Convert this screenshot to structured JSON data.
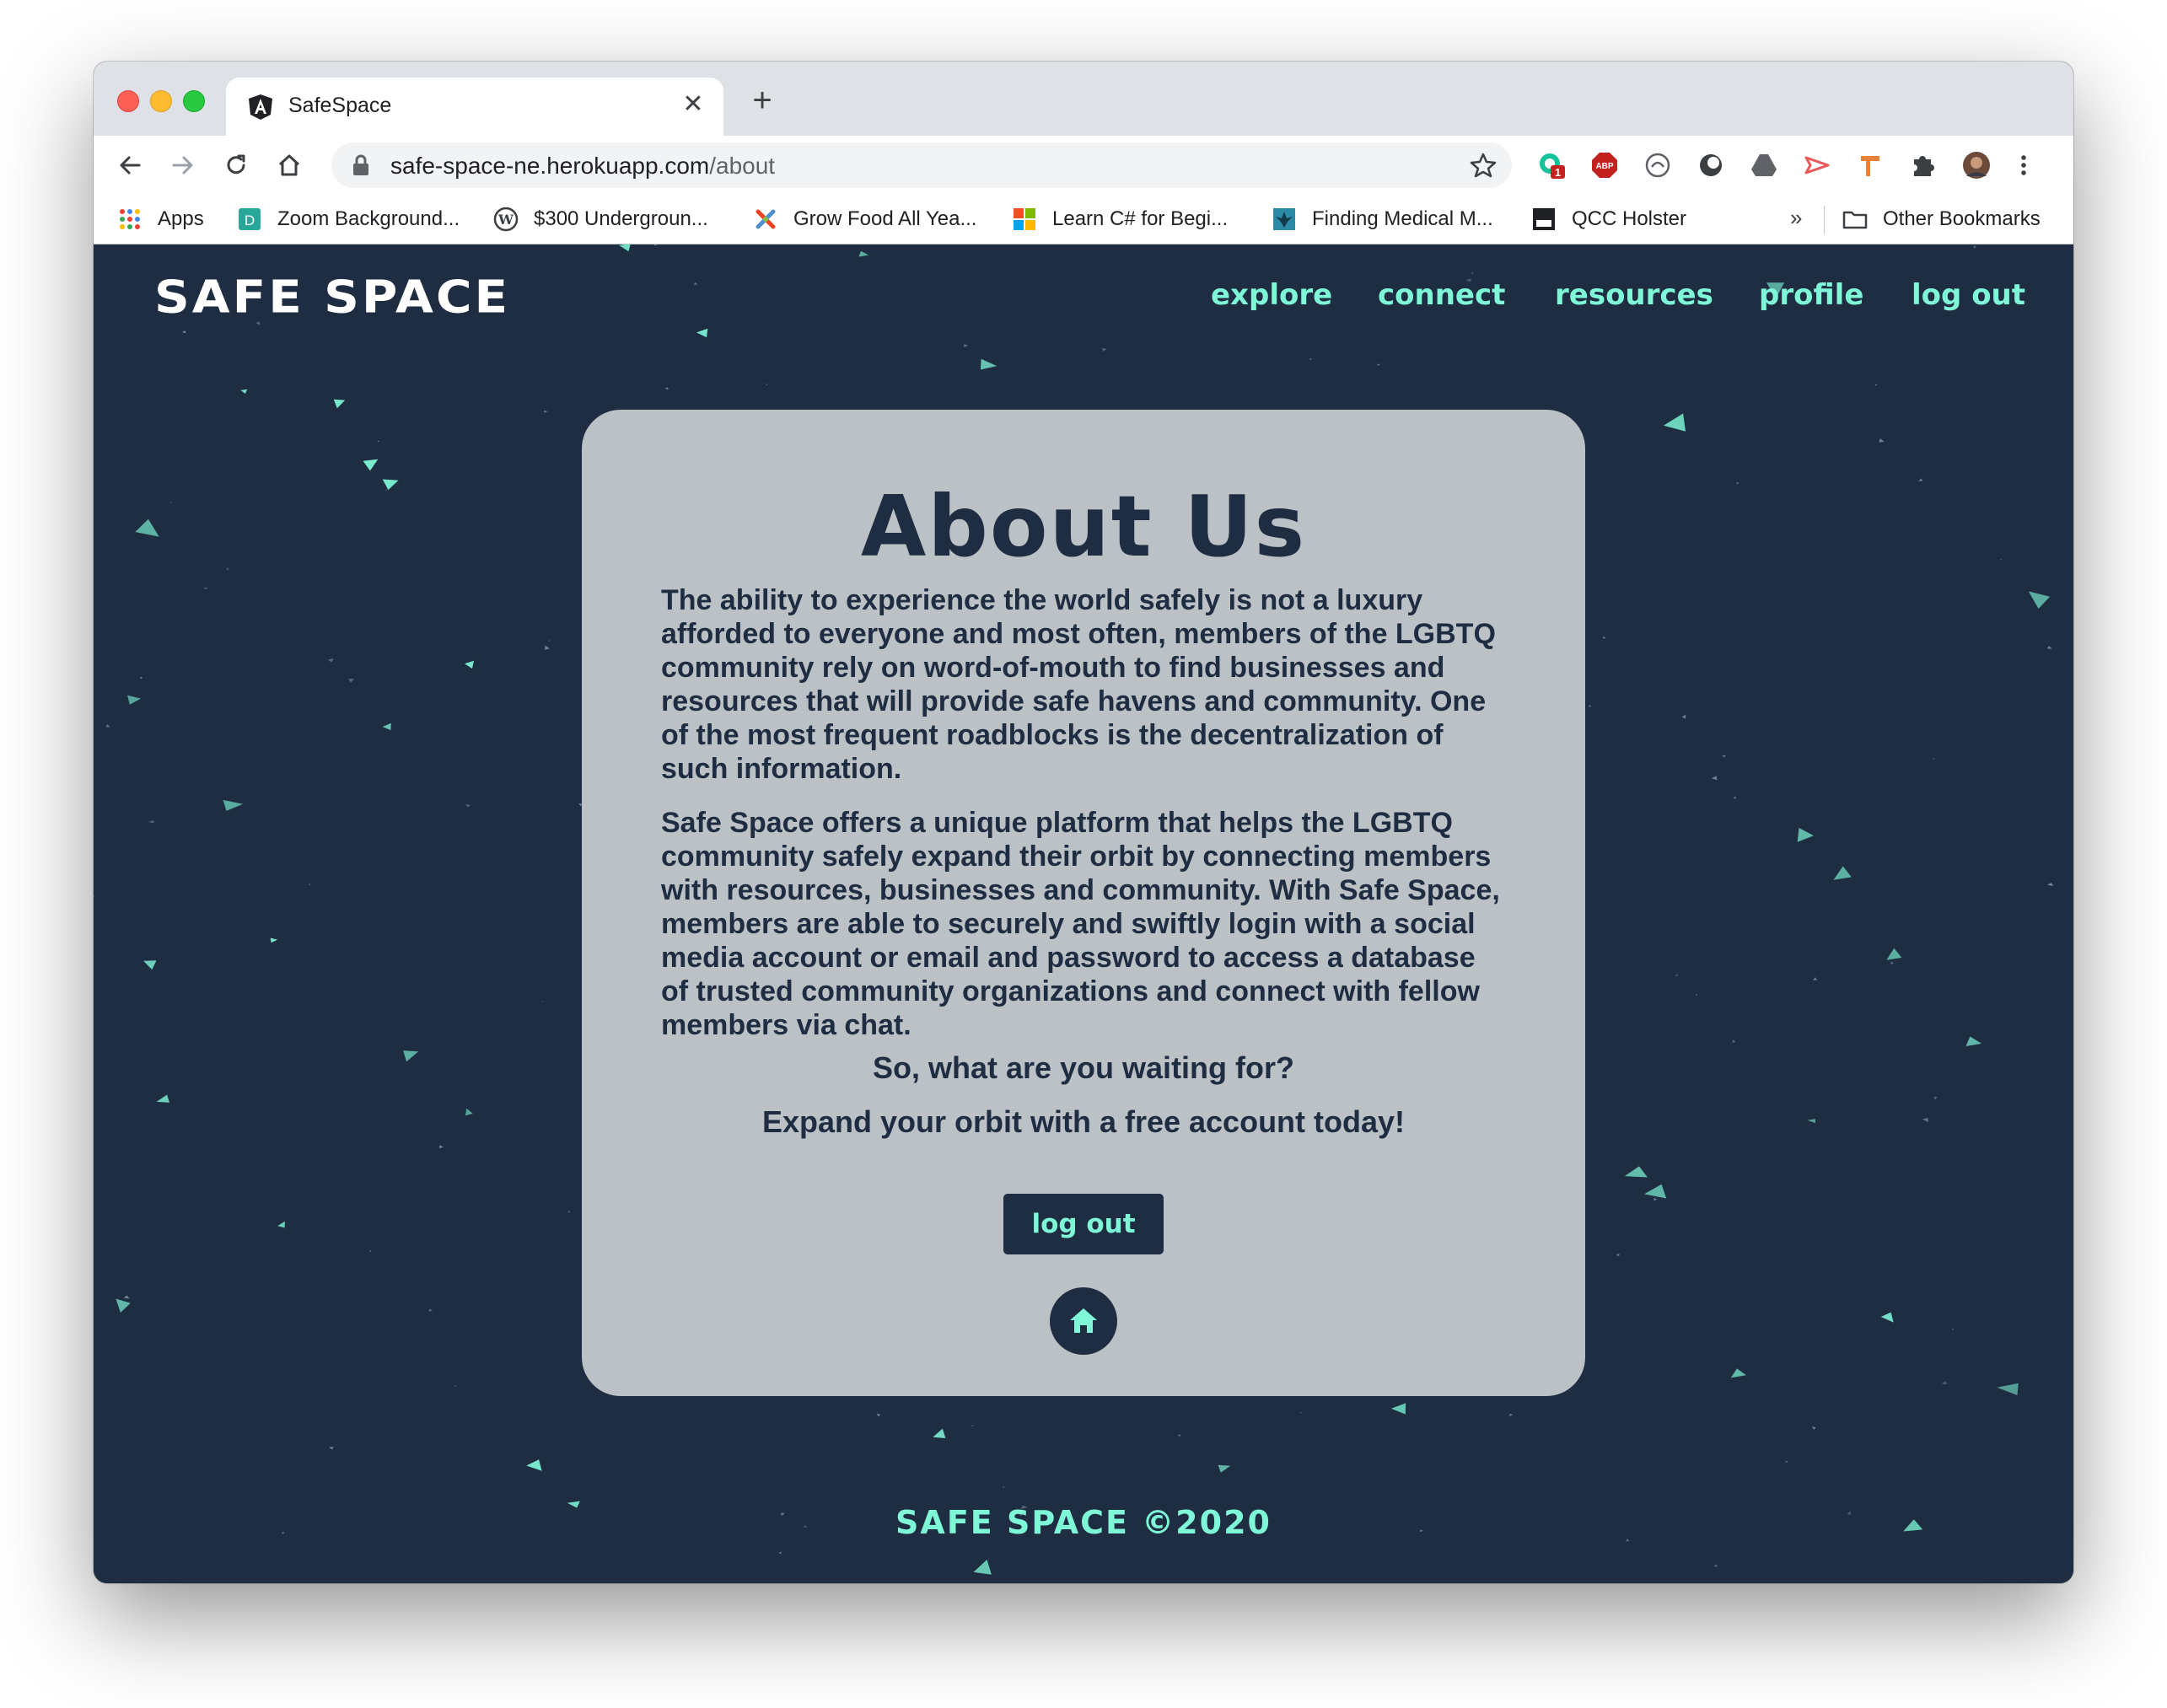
{
  "browser": {
    "tab": {
      "title": "SafeSpace",
      "favicon": "angular-icon",
      "close_icon": "close-icon"
    },
    "new_tab_icon": "plus-icon",
    "url": {
      "host": "safe-space-ne.herokuapp.com",
      "path": "/about"
    },
    "nav_icons": [
      "back-icon",
      "forward-icon",
      "reload-icon",
      "home-icon"
    ],
    "extensions": [
      {
        "icon": "grammarly-icon",
        "badge": "1"
      },
      {
        "icon": "adblock-icon",
        "label": "ABP"
      },
      {
        "icon": "privacy-icon"
      },
      {
        "icon": "circle-icon"
      },
      {
        "icon": "drive-icon"
      },
      {
        "icon": "cast-icon"
      },
      {
        "icon": "hammer-icon"
      },
      {
        "icon": "puzzle-icon"
      },
      {
        "icon": "avatar-icon"
      },
      {
        "icon": "kebab-menu-icon"
      }
    ],
    "bookmarks": [
      {
        "label": "Apps",
        "icon": "apps-grid-icon"
      },
      {
        "label": "Zoom Background...",
        "icon": "bookmark-d-icon"
      },
      {
        "label": "$300 Undergroun...",
        "icon": "wordpress-icon"
      },
      {
        "label": "Grow Food All Yea...",
        "icon": "joomla-icon"
      },
      {
        "label": "Learn C# for Begi...",
        "icon": "microsoft-icon"
      },
      {
        "label": "Finding Medical M...",
        "icon": "leaf-icon"
      },
      {
        "label": "QCC Holster",
        "icon": "jm4-icon"
      }
    ],
    "bookmarks_overflow": "»",
    "other_bookmarks": "Other Bookmarks"
  },
  "site": {
    "brand": "SAFE SPACE",
    "nav": [
      "explore",
      "connect",
      "resources",
      "profile",
      "log out"
    ],
    "accent_color": "#7ff8d8",
    "background_color": "#1f2d42",
    "card_color": "#bcc1c6"
  },
  "about": {
    "title": "About Us",
    "paragraph1": "The ability to experience the world safely is not a luxury afforded to everyone and most often, members of the LGBTQ community rely on word-of-mouth to find businesses and resources that will provide safe havens and community. One of the most frequent roadblocks is the decentralization of such information.",
    "paragraph2": "Safe Space offers a unique platform that helps the LGBTQ community safely expand their orbit by connecting members with resources, businesses and community. With Safe Space, members are able to securely and swiftly login with a social media account or email and password to access a database of trusted community organizations and connect with fellow members via chat.",
    "cta1": "So, what are you waiting for?",
    "cta2": "Expand your orbit with a free account today!",
    "logout_button": "log out",
    "home_icon": "home-icon"
  },
  "footer": {
    "text": "SAFE SPACE  ©2020"
  }
}
